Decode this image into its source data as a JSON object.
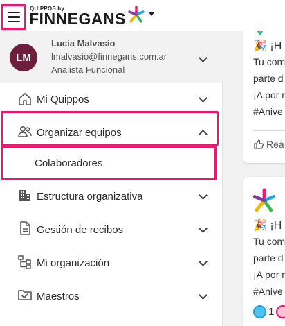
{
  "colors": {
    "highlight": "#e8196f",
    "avatar_bg": "#6e1f3d",
    "profile_bg": "#f2f2f2",
    "star_colors": [
      "#f0187a",
      "#2aa5e0",
      "#3bb54a",
      "#f7b500",
      "#7b3fa0"
    ]
  },
  "header": {
    "logo_small": "QUIPPOS by",
    "logo_name": "FINNEGANS",
    "menu_icon": "hamburger-menu-icon",
    "caret_icon": "caret-down-icon"
  },
  "profile": {
    "initials": "LM",
    "name": "Lucia Malvasio",
    "email": "lmalvasio@finnegans.com.ar",
    "role": "Analista Funcional"
  },
  "sidebar": {
    "items": [
      {
        "label": "Mi Quippos",
        "icon": "home-icon",
        "expanded": false
      },
      {
        "label": "Organizar equipos",
        "icon": "people-icon",
        "expanded": true
      },
      {
        "label": "Colaboradores",
        "icon": "",
        "sub": true
      },
      {
        "label": "Estructura organizativa",
        "icon": "building-icon",
        "expanded": false
      },
      {
        "label": "Gestión de recibos",
        "icon": "document-icon",
        "expanded": false
      },
      {
        "label": "Mi organización",
        "icon": "org-chart-icon",
        "expanded": false
      },
      {
        "label": "Maestros",
        "icon": "folder-check-icon",
        "expanded": false
      }
    ]
  },
  "feed": {
    "cards": [
      {
        "title": "🎉 ¡H",
        "lines": [
          "Tu com",
          "parte d",
          "¡A por n",
          "#Anive"
        ],
        "like_label": "Rea"
      },
      {
        "title": "🎉 ¡H",
        "lines": [
          "Tu com",
          "parte d",
          "¡A por n",
          "#Anive"
        ],
        "reaction_count": "1"
      }
    ]
  }
}
